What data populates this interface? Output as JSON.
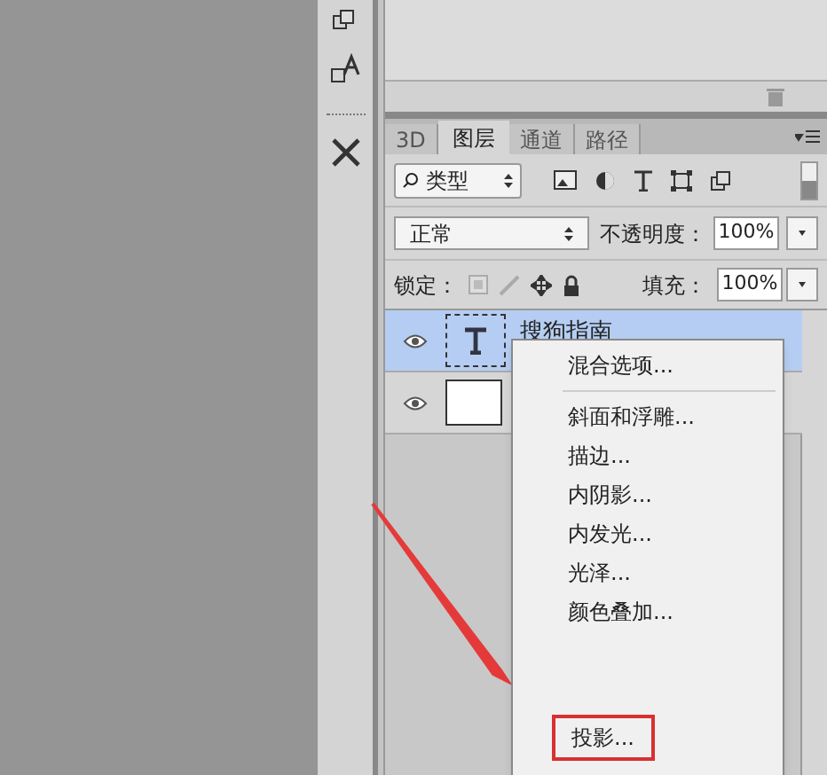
{
  "panel_tabs": [
    {
      "label": "3D",
      "selected": false
    },
    {
      "label": "图层",
      "selected": true
    },
    {
      "label": "通道",
      "selected": false
    },
    {
      "label": "路径",
      "selected": false
    }
  ],
  "filter": {
    "value": "类型"
  },
  "blend_mode": {
    "value": "正常"
  },
  "opacity": {
    "label": "不透明度：",
    "value": "100%"
  },
  "lock": {
    "label": "锁定："
  },
  "fill": {
    "label": "填充：",
    "value": "100%"
  },
  "layers": [
    {
      "kind": "text",
      "name": "搜狗指南",
      "selected": true
    },
    {
      "kind": "fill",
      "selected": false
    }
  ],
  "context_menu": {
    "items": [
      {
        "label": "混合选项...",
        "separator_after": true,
        "annotated": false
      },
      {
        "label": "斜面和浮雕...",
        "separator_after": false,
        "annotated": false
      },
      {
        "label": "描边...",
        "separator_after": false,
        "annotated": false
      },
      {
        "label": "内阴影...",
        "separator_after": false,
        "annotated": false
      },
      {
        "label": "内发光...",
        "separator_after": false,
        "annotated": false
      },
      {
        "label": "光泽...",
        "separator_after": false,
        "annotated": false
      },
      {
        "label": "颜色叠加...",
        "separator_after": false,
        "annotated": false
      },
      {
        "label": "投影...",
        "separator_after": false,
        "annotated": true
      }
    ]
  }
}
